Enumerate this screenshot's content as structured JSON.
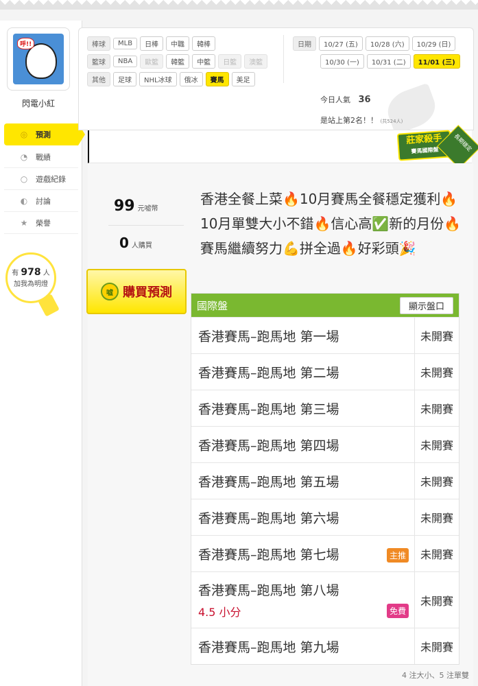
{
  "user": {
    "name": "閃電小紅",
    "avatar_bubble": "呼!!"
  },
  "nav": [
    {
      "label": "預測",
      "icon": "target-icon",
      "active": true
    },
    {
      "label": "戰績",
      "icon": "chart-icon"
    },
    {
      "label": "遊戲紀錄",
      "icon": "record-icon"
    },
    {
      "label": "討論",
      "icon": "chat-icon"
    },
    {
      "label": "榮譽",
      "icon": "medal-icon"
    }
  ],
  "fans": {
    "prefix": "有",
    "count": "978",
    "unit": "人",
    "caption": "加我為明燈"
  },
  "filters": {
    "baseball": {
      "label": "棒球",
      "items": [
        "MLB",
        "日棒",
        "中職",
        "韓棒"
      ]
    },
    "basketball": {
      "label": "籃球",
      "items": [
        "NBA",
        "歐籃",
        "韓籃",
        "中籃",
        "日籃",
        "澳籃"
      ]
    },
    "other": {
      "label": "其他",
      "items": [
        "足球",
        "NHL冰球",
        "俄冰",
        "賽馬",
        "美足"
      ]
    }
  },
  "dates": {
    "label": "日期",
    "row1": [
      "10/27 (五)",
      "10/28 (六)",
      "10/29 (日)"
    ],
    "row2": [
      "10/30 (一)",
      "10/31 (二)",
      "11/01 (三)"
    ]
  },
  "stats": {
    "popular_label": "今日人氣",
    "popular_value": "36",
    "rank_text": "是站上第2名！！",
    "rank_note": "(共524人)"
  },
  "badge": {
    "title": "莊家殺手",
    "subtitle": "賽馬國際盤",
    "ribbon": "長期穩定"
  },
  "pricing": {
    "price": "99",
    "price_unit": "元嘘幣",
    "buyers": "0",
    "buyers_unit": "人購買",
    "buy_label": "購買預測",
    "coin_label": "嘘"
  },
  "description": "香港全餐上菜🔥10月賽馬全餐穩定獲利🔥10月單雙大小不錯🔥信心高✅新的月份🔥賽馬繼續努力💪拼全過🔥好彩頭🎉",
  "table": {
    "title": "國際盤",
    "toggle_label": "顯示盤口",
    "rows": [
      {
        "name": "香港賽馬–跑馬地 第一場",
        "status": "未開賽"
      },
      {
        "name": "香港賽馬–跑馬地 第二場",
        "status": "未開賽"
      },
      {
        "name": "香港賽馬–跑馬地 第三場",
        "status": "未開賽"
      },
      {
        "name": "香港賽馬–跑馬地 第四場",
        "status": "未開賽"
      },
      {
        "name": "香港賽馬–跑馬地 第五場",
        "status": "未開賽"
      },
      {
        "name": "香港賽馬–跑馬地 第六場",
        "status": "未開賽"
      },
      {
        "name": "香港賽馬–跑馬地 第七場",
        "status": "未開賽",
        "tag": "主推"
      },
      {
        "name": "香港賽馬–跑馬地 第八場",
        "status": "未開賽",
        "sub": "4.5 小分",
        "tag": "免費"
      },
      {
        "name": "香港賽馬–跑馬地 第九場",
        "status": "未開賽"
      }
    ],
    "footnote": "4 注大小、5 注單雙"
  }
}
